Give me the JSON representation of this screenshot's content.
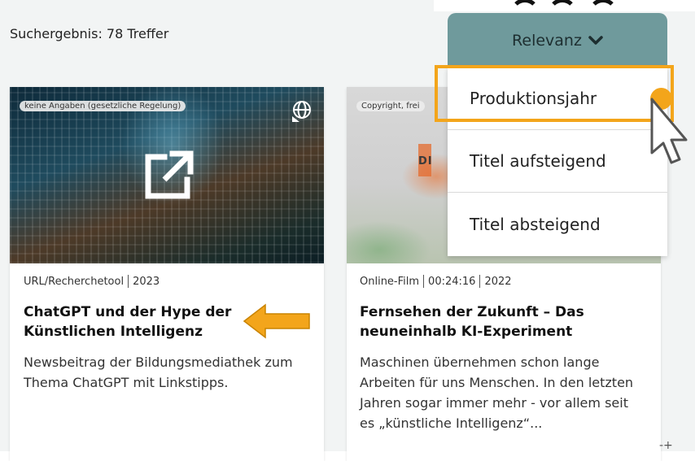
{
  "results": {
    "count_text": "Suchergebnis: 78 Treffer"
  },
  "sort": {
    "selected": "Relevanz",
    "options": [
      "Produktionsjahr",
      "Titel aufsteigend",
      "Titel absteigend"
    ]
  },
  "cards": [
    {
      "copyright": "keine Angaben (gesetzliche Regelung)",
      "type": "URL/Recherchetool",
      "year": "2023",
      "title": "ChatGPT und der Hype der Künstlichen Intelligenz",
      "description": "Newsbeitrag der Bildungsmediathek zum Thema ChatGPT mit Linkstipps.",
      "icons": [
        "web-icon",
        "external-link-icon"
      ]
    },
    {
      "copyright": "Copyright, frei",
      "type": "Online-Film",
      "duration": "00:24:16",
      "year": "2022",
      "title": "Fernsehen der Zukunft – Das neuneinhalb KI-Experiment",
      "description": "Maschinen übernehmen schon lange Arbeiten für uns Menschen. In den letzten Jahren sogar immer mehr - vor allem seit es „künstliche Intelligenz“...",
      "thumb_text": "DI"
    }
  ],
  "colors": {
    "accent": "#f3a51b",
    "sort_button": "#6f9a9c"
  }
}
